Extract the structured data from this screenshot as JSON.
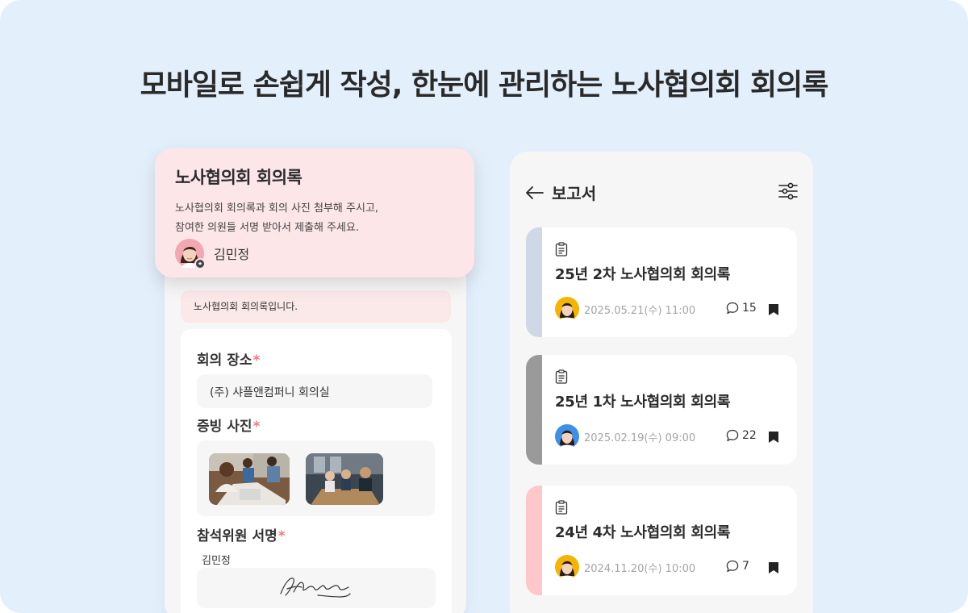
{
  "headline": "모바일로 손쉽게 작성, 한눈에 관리하는 노사협의회 회의록",
  "popup": {
    "title": "노사협의회 회의록",
    "desc_line1": "노사협의회 회의록과 회의 사진 첨부해 주시고,",
    "desc_line2": "참여한 의원들 서명 받아서 제출해 주세요.",
    "author": "김민정"
  },
  "form": {
    "notice": "노사협의회 회의록입니다.",
    "location_label": "회의 장소",
    "location_value": "(주) 샤플앤컴퍼니 회의실",
    "photo_label": "증빙 사진",
    "signature_label": "참석위원 서명",
    "required_mark": "*",
    "signer_name": "김민정"
  },
  "reports_screen": {
    "title": "보고서",
    "back_icon": "arrow-left-icon",
    "filter_icon": "sliders-icon",
    "items": [
      {
        "title": "25년 2차 노사협의회 회의록",
        "date": "2025.05.21(수) 11:00",
        "comments": "15",
        "accent": "#cfd8e6",
        "avatar_bg": "#f5b400"
      },
      {
        "title": "25년 1차 노사협의회 회의록",
        "date": "2025.02.19(수) 09:00",
        "comments": "22",
        "accent": "#9a9a9a",
        "avatar_bg": "#3f8ee8"
      },
      {
        "title": "24년 4차 노사협의회 회의록",
        "date": "2024.11.20(수) 10:00",
        "comments": "7",
        "accent": "#ffc7c9",
        "avatar_bg": "#f5b400"
      }
    ]
  },
  "colors": {
    "background": "#e3f0fc",
    "popup_bg": "#fde6e7",
    "required": "#f07a80"
  }
}
